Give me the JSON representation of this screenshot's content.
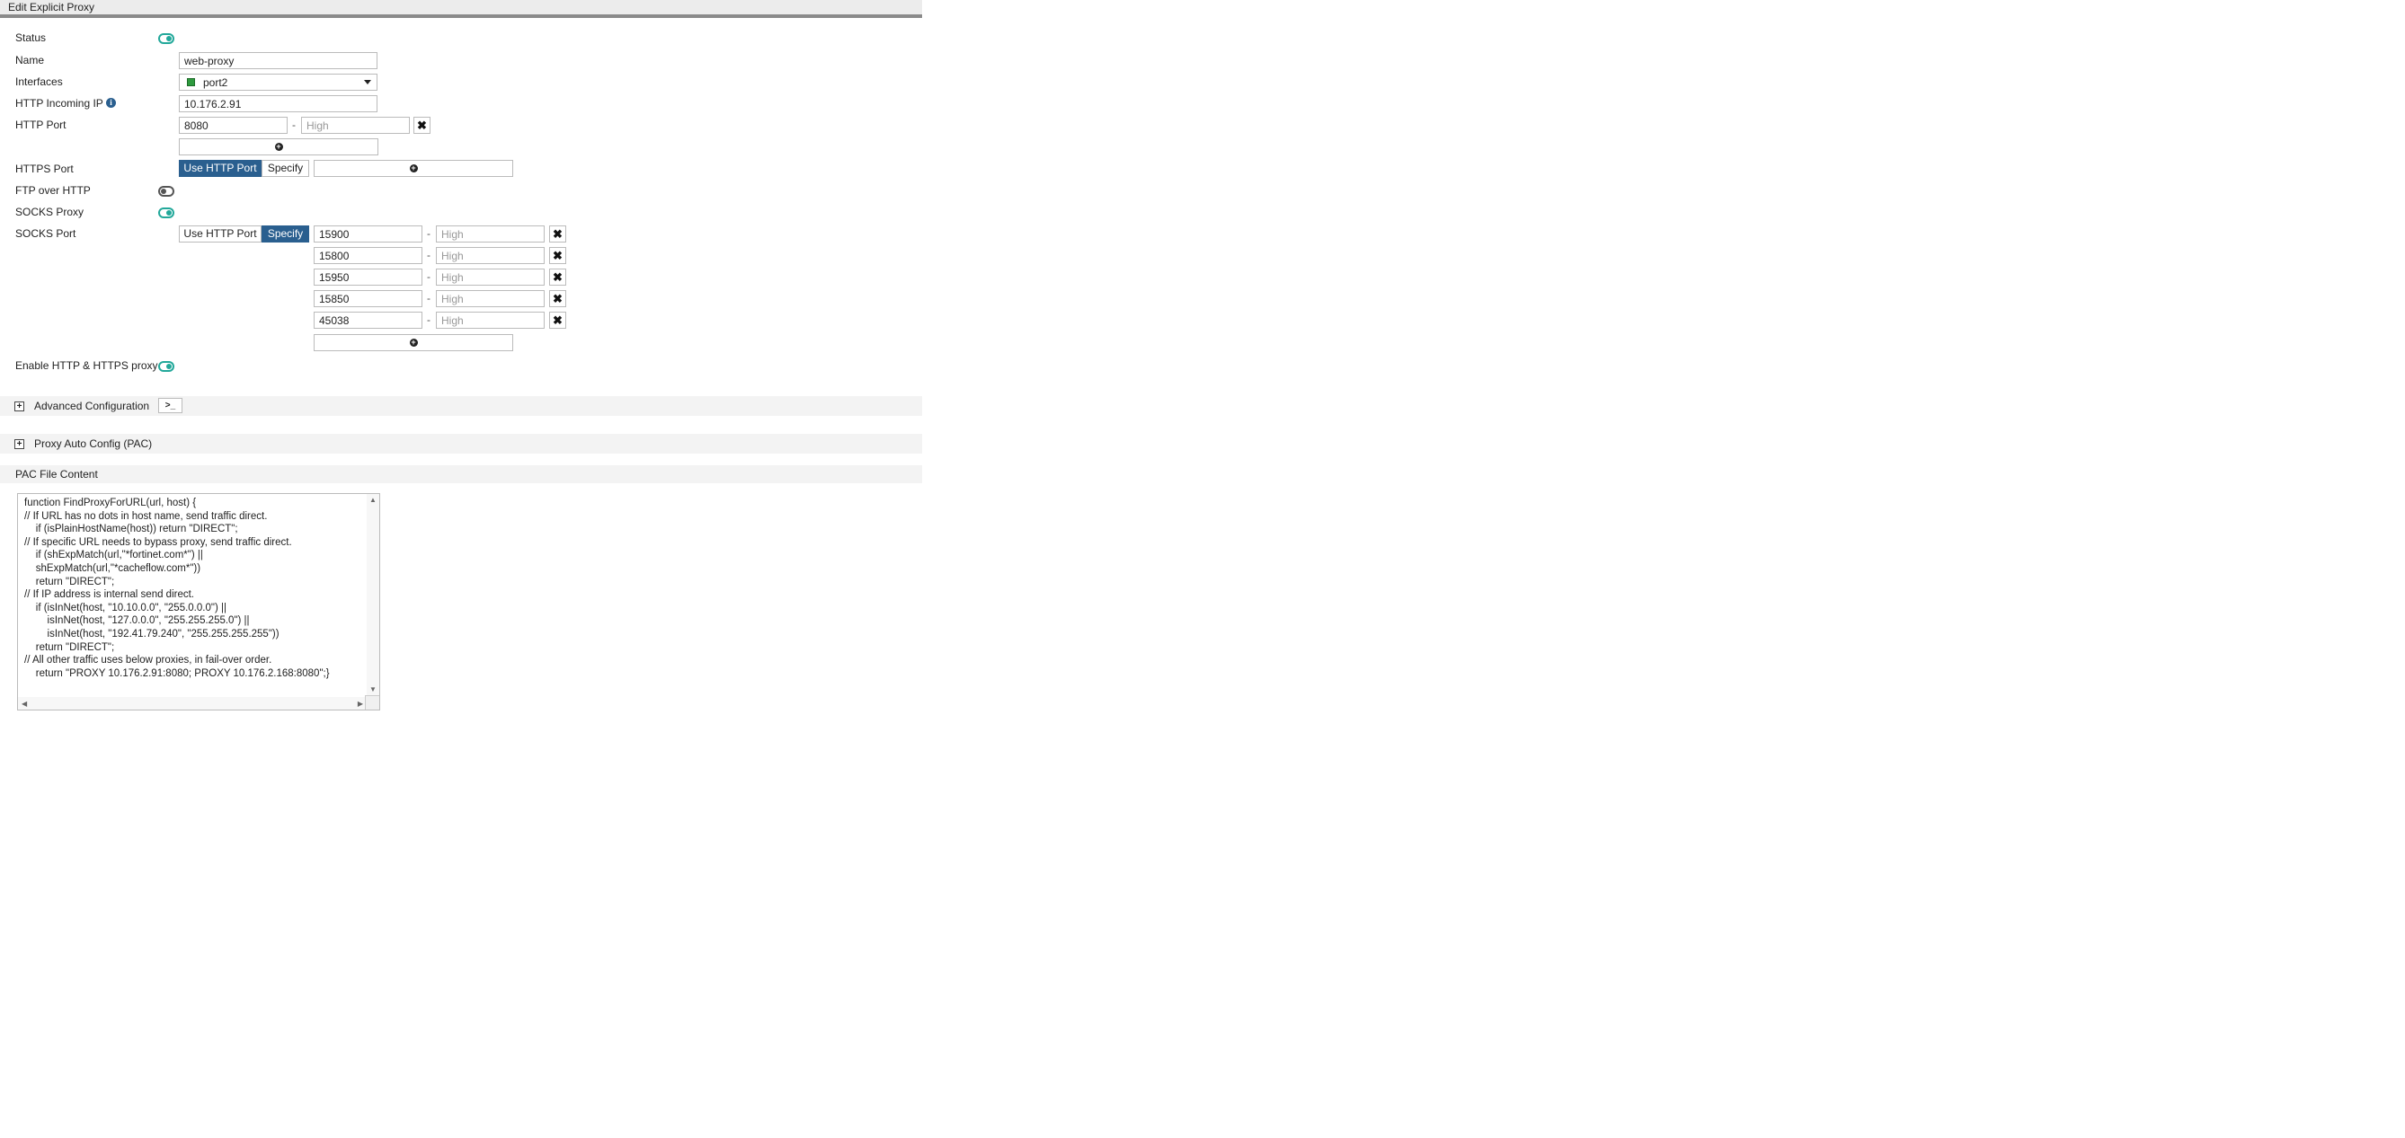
{
  "window": {
    "title": "Edit Explicit Proxy"
  },
  "form": {
    "status_label": "Status",
    "name_label": "Name",
    "name_value": "web-proxy",
    "interfaces_label": "Interfaces",
    "interface_value": "port2",
    "incoming_ip_label": "HTTP Incoming IP",
    "incoming_ip_value": "10.176.2.91",
    "http_port_label": "HTTP Port",
    "http_port_low": "8080",
    "high_placeholder": "High",
    "dash": "-",
    "https_port_label": "HTTPS Port",
    "use_http_port": "Use HTTP Port",
    "specify": "Specify",
    "ftp_label": "FTP over HTTP",
    "socks_proxy_label": "SOCKS Proxy",
    "socks_port_label": "SOCKS Port",
    "socks_ports": [
      "15900",
      "15800",
      "15950",
      "15850",
      "45038"
    ],
    "enable_label": "Enable HTTP & HTTPS proxy"
  },
  "toggles": {
    "status": true,
    "ftp_over_http": false,
    "socks_proxy": true,
    "enable_http_https": true
  },
  "sections": {
    "advanced": "Advanced Configuration",
    "pac": "Proxy Auto Config (PAC)",
    "pac_content": "PAC File Content",
    "expand_symbol": "+"
  },
  "pac_code": "function FindProxyForURL(url, host) {\n// If URL has no dots in host name, send traffic direct.\n    if (isPlainHostName(host)) return \"DIRECT\";\n// If specific URL needs to bypass proxy, send traffic direct.\n    if (shExpMatch(url,\"*fortinet.com*\") ||\n    shExpMatch(url,\"*cacheflow.com*\"))\n    return \"DIRECT\";\n// If IP address is internal send direct.\n    if (isInNet(host, \"10.10.0.0\", \"255.0.0.0\") ||\n        isInNet(host, \"127.0.0.0\", \"255.255.255.0\") ||\n        isInNet(host, \"192.41.79.240\", \"255.255.255.255\"))\n    return \"DIRECT\";\n// All other traffic uses below proxies, in fail-over order.\n    return \"PROXY 10.176.2.91:8080; PROXY 10.176.2.168:8080\";}",
  "icons": {
    "info": "info-icon",
    "remove": "close-icon",
    "add": "plus-circle-icon",
    "cli": "cli-icon"
  },
  "colors": {
    "accent": "#2a5f8f",
    "toggle_on": "#22a89a",
    "interface_icon": "#2e9a3e"
  }
}
